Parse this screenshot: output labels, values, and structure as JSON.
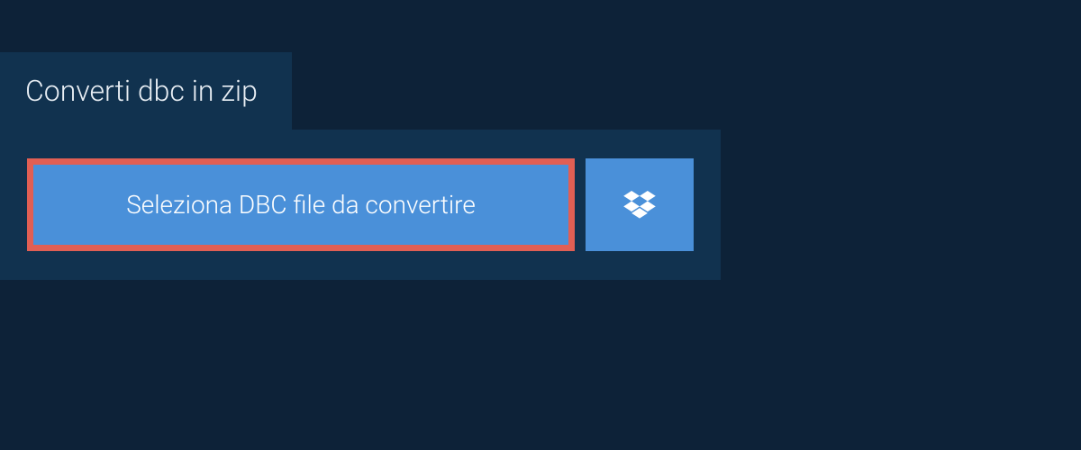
{
  "tab": {
    "title": "Converti dbc in zip"
  },
  "actions": {
    "select_label": "Seleziona DBC file da convertire"
  }
}
